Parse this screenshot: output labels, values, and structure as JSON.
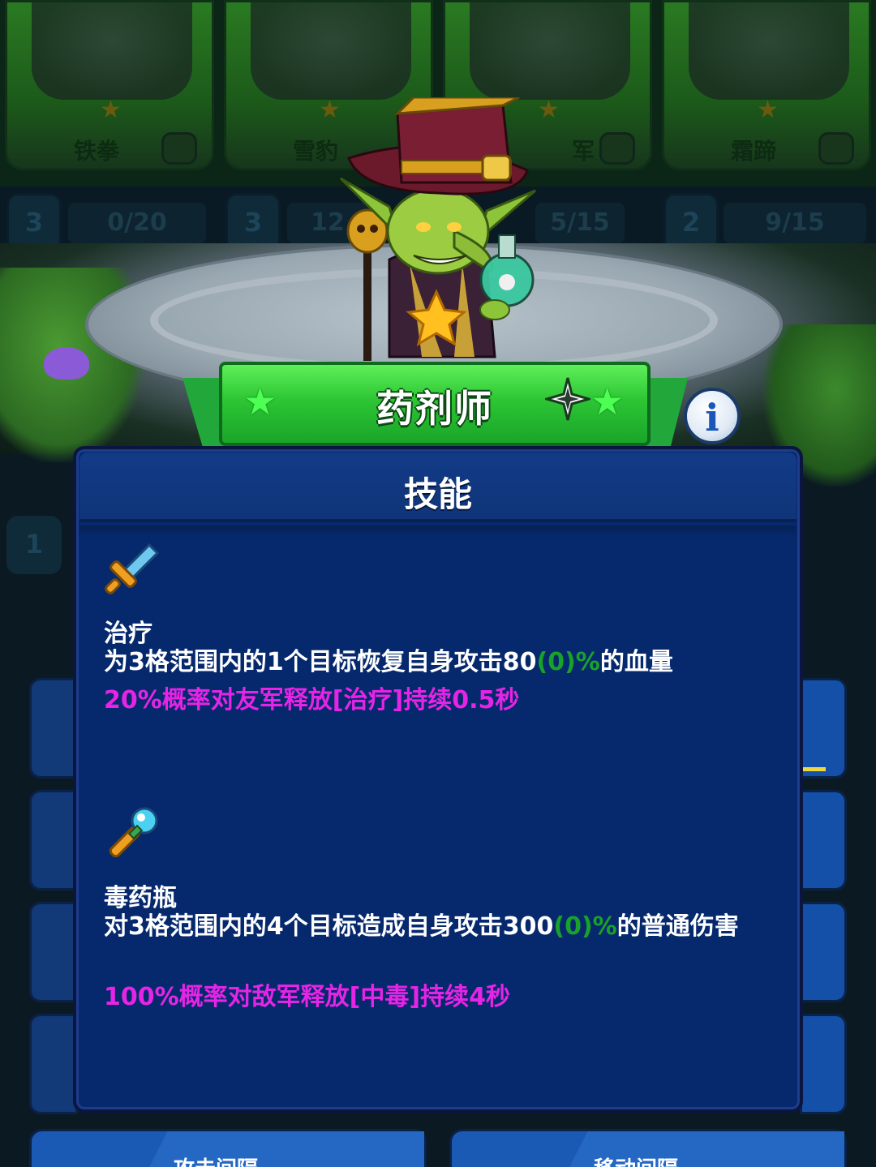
{
  "background": {
    "hero_cards": [
      {
        "name": "铁拳",
        "stars": 1
      },
      {
        "name": "雪豹",
        "stars": 1
      },
      {
        "name": "军",
        "stars": 1
      },
      {
        "name": "霜蹄",
        "stars": 1
      }
    ],
    "levels": [
      "3",
      "3",
      "",
      "2"
    ],
    "progress": [
      "0/20",
      "12",
      "5/15",
      "9/15"
    ],
    "side_level": "1",
    "bottom_buttons": [
      "攻击间隔",
      "移动间隔"
    ]
  },
  "hero": {
    "name": "药剂师",
    "star_level": 1,
    "colors": {
      "banner": "#2dc534",
      "star": "#4dff52",
      "panel": "#06296d"
    }
  },
  "info_button": {
    "label": "i"
  },
  "skill_panel": {
    "title": "技能",
    "skills": [
      {
        "icon": "sword-icon",
        "name": "治疗",
        "desc_pre": "为3格范围内的1个目标恢复自身攻击80",
        "desc_green": "(0)%",
        "desc_post": "的血量",
        "buff": "20%概率对友军释放[治疗]持续0.5秒"
      },
      {
        "icon": "potion-wand-icon",
        "name": "毒药瓶",
        "desc_pre": "对3格范围内的4个目标造成自身攻击300",
        "desc_green": "(0)%",
        "desc_post": "的普通伤害",
        "buff": "100%概率对敌军释放[中毒]持续4秒"
      }
    ]
  }
}
